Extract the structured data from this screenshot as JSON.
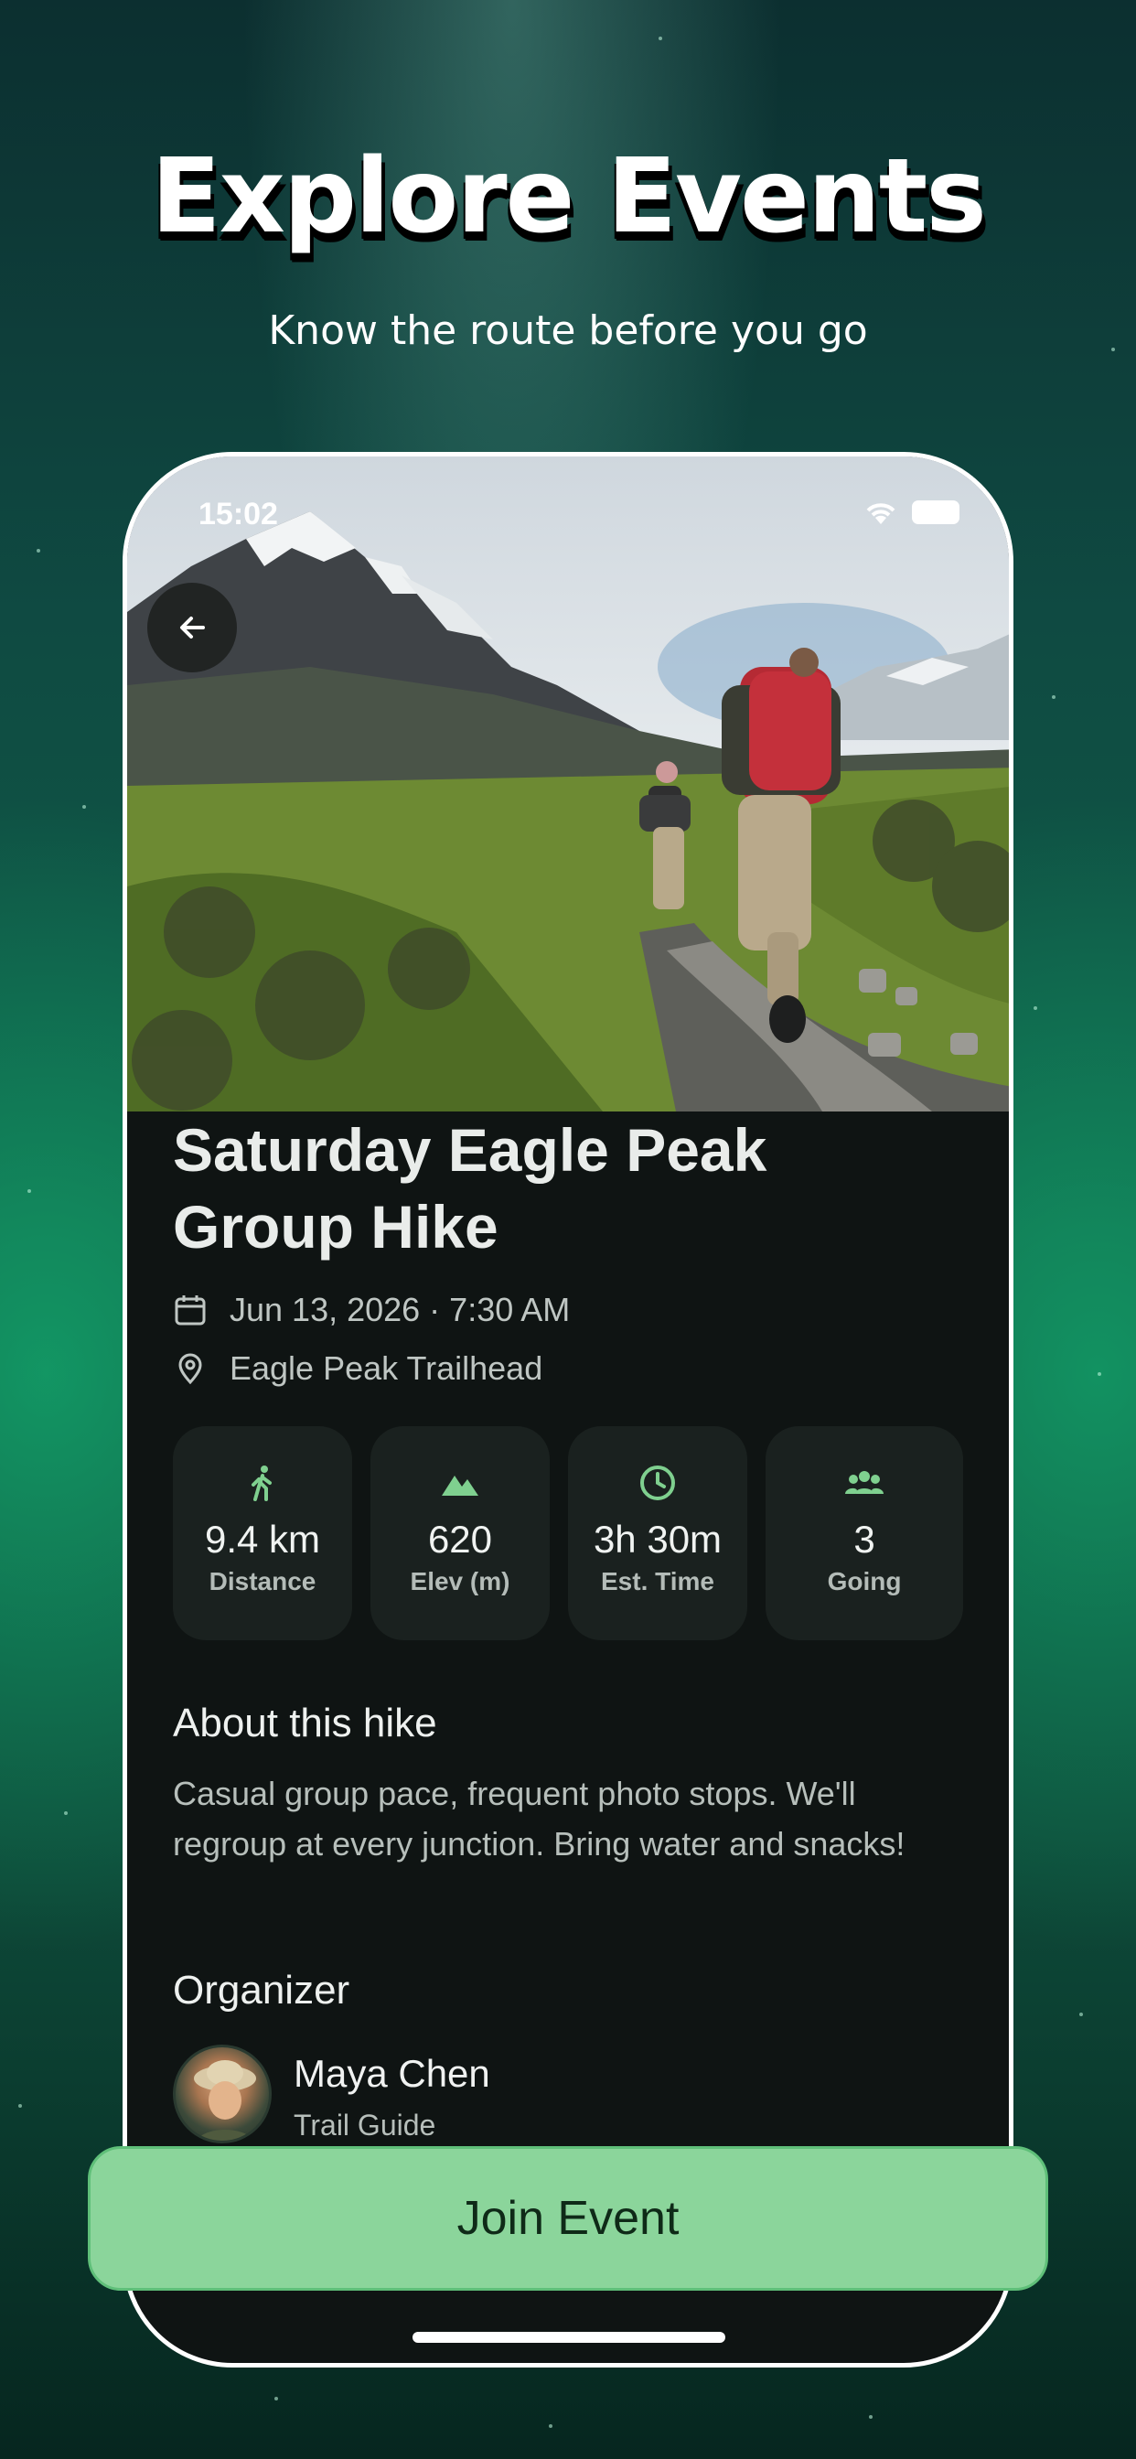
{
  "promo": {
    "title": "Explore Events",
    "subtitle": "Know the route before you go"
  },
  "status_bar": {
    "time": "15:02",
    "icons": [
      "wifi-icon",
      "battery-icon"
    ]
  },
  "navigation": {
    "back_icon": "arrow-left-icon"
  },
  "event": {
    "title": "Saturday Eagle Peak Group Hike",
    "date_time": "Jun 13, 2026 · 7:30 AM",
    "location": "Eagle Peak Trailhead",
    "stats": [
      {
        "icon": "walking-icon",
        "value": "9.4 km",
        "label": "Distance"
      },
      {
        "icon": "mountain-icon",
        "value": "620",
        "label": "Elev (m)"
      },
      {
        "icon": "clock-icon",
        "value": "3h 30m",
        "label": "Est. Time"
      },
      {
        "icon": "group-icon",
        "value": "3",
        "label": "Going"
      }
    ],
    "about_title": "About this hike",
    "about_text": "Casual group pace, frequent photo stops. We'll regroup at every junction. Bring water and snacks!",
    "organizer_title": "Organizer",
    "organizer": {
      "name": "Maya Chen",
      "role": "Trail Guide"
    }
  },
  "cta": {
    "join_label": "Join Event"
  },
  "colors": {
    "accent": "#8bd59b",
    "icon_green": "#7fd08f",
    "card_bg": "#1a211f",
    "screen_bg": "#0f1413"
  }
}
